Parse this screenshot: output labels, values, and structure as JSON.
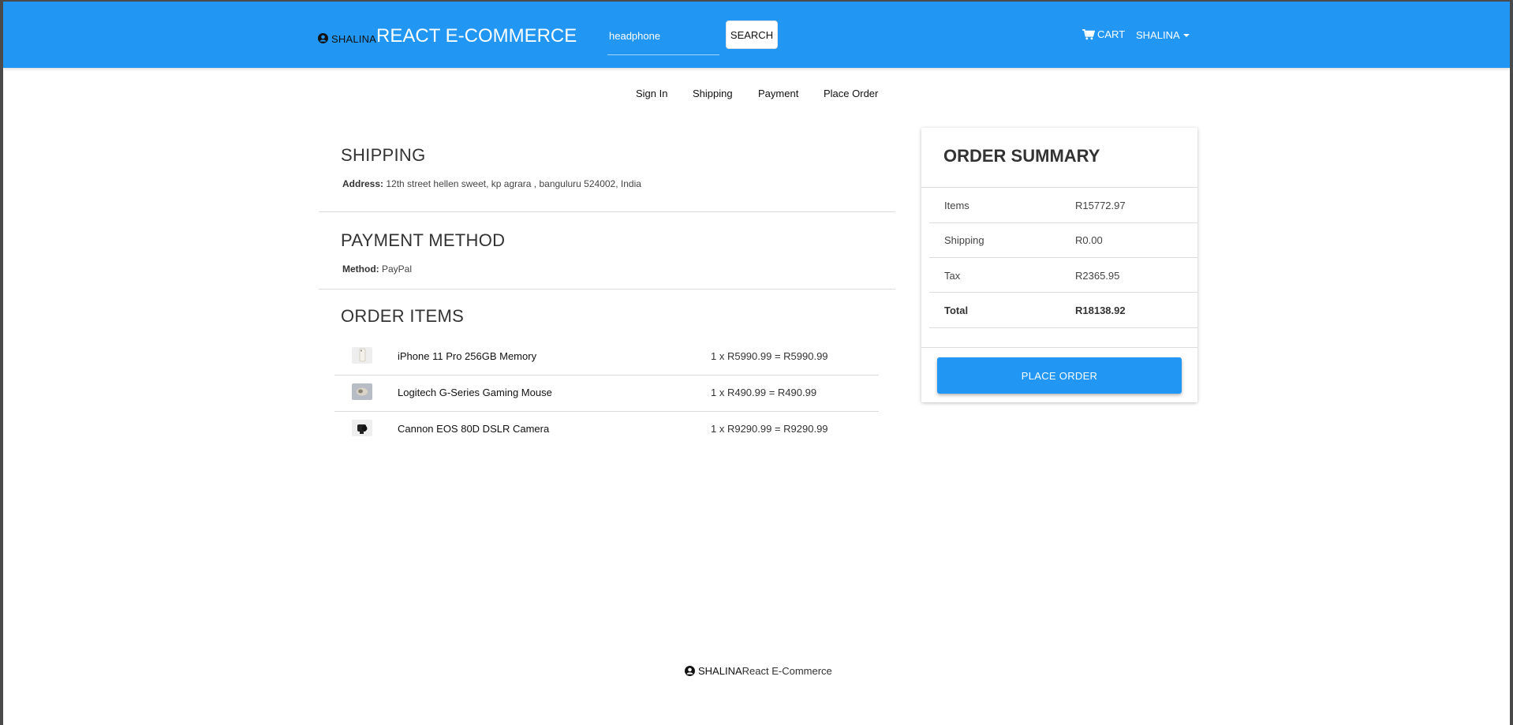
{
  "navbar": {
    "brand_small": "SHALINA",
    "brand_big": "REACT E-COMMERCE",
    "search_value": "headphone",
    "search_button": "SEARCH",
    "cart_label": "CART",
    "user_label": "SHALINA",
    "color": "#2196f3"
  },
  "steps": [
    "Sign In",
    "Shipping",
    "Payment",
    "Place Order"
  ],
  "shipping": {
    "title": "SHIPPING",
    "address_label": "Address:",
    "address_value": "12th street hellen sweet, kp agrara , banguluru 524002, India"
  },
  "payment": {
    "title": "PAYMENT METHOD",
    "method_label": "Method:",
    "method_value": "PayPal"
  },
  "order_items": {
    "title": "ORDER ITEMS",
    "items": [
      {
        "name": "iPhone 11 Pro 256GB Memory",
        "price": "1 x R5990.99 = R5990.99",
        "thumb": "phone-thumbnail"
      },
      {
        "name": "Logitech G-Series Gaming Mouse",
        "price": "1 x R490.99 = R490.99",
        "thumb": "mouse-thumbnail"
      },
      {
        "name": "Cannon EOS 80D DSLR Camera",
        "price": "1 x R9290.99 = R9290.99",
        "thumb": "camera-thumbnail"
      }
    ]
  },
  "summary": {
    "title": "ORDER SUMMARY",
    "rows": [
      {
        "label": "Items",
        "value": "R15772.97"
      },
      {
        "label": "Shipping",
        "value": "R0.00"
      },
      {
        "label": "Tax",
        "value": "R2365.95"
      },
      {
        "label": "Total",
        "value": "R18138.92"
      }
    ],
    "button": "PLACE ORDER"
  },
  "footer": {
    "brand": "SHALINA",
    "text": "React E-Commerce"
  }
}
